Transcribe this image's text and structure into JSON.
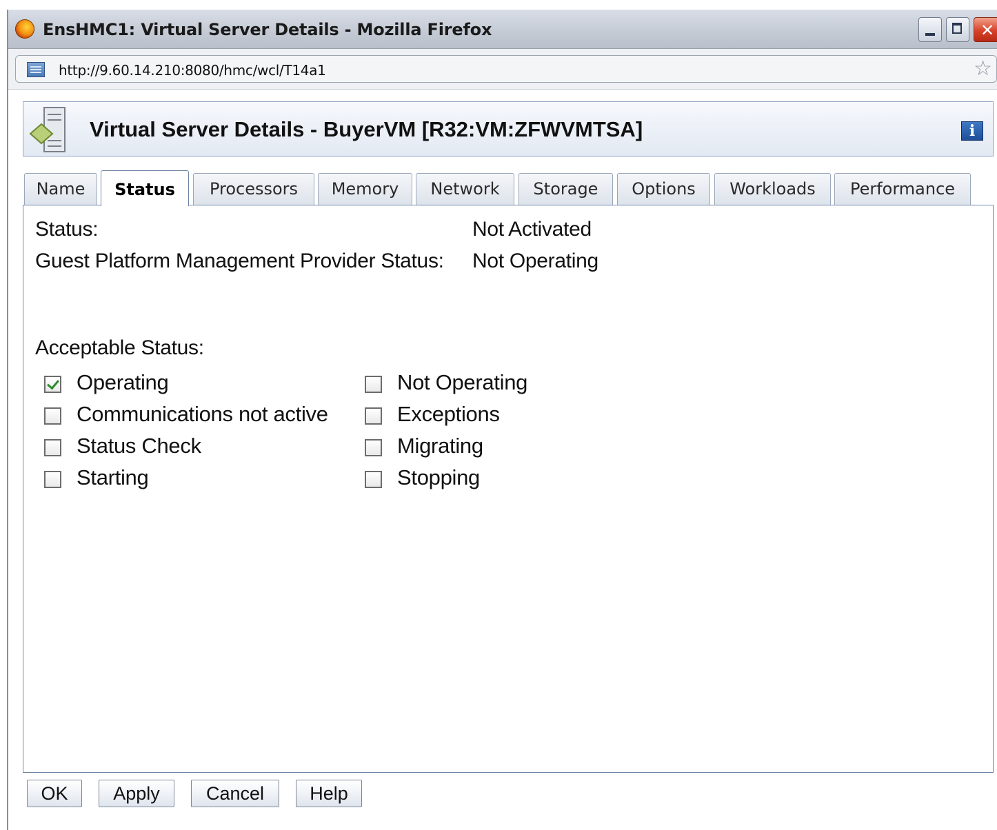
{
  "window": {
    "title": "EnsHMC1: Virtual Server Details - Mozilla Firefox",
    "url": "http://9.60.14.210:8080/hmc/wcl/T14a1",
    "close_glyph": "✕"
  },
  "header": {
    "title": "Virtual Server Details - BuyerVM [R32:VM:ZFWVMTSA]",
    "info_glyph": "i"
  },
  "tabs": [
    {
      "label": "Name",
      "active": false
    },
    {
      "label": "Status",
      "active": true
    },
    {
      "label": "Processors",
      "active": false
    },
    {
      "label": "Memory",
      "active": false
    },
    {
      "label": "Network",
      "active": false
    },
    {
      "label": "Storage",
      "active": false
    },
    {
      "label": "Options",
      "active": false
    },
    {
      "label": "Workloads",
      "active": false
    },
    {
      "label": "Performance",
      "active": false
    }
  ],
  "status": {
    "status_label": "Status:",
    "status_value": "Not Activated",
    "gpmp_label": "Guest Platform Management Provider Status:",
    "gpmp_value": "Not Operating"
  },
  "acceptable": {
    "heading": "Acceptable Status:",
    "options": [
      {
        "label": "Operating",
        "checked": true
      },
      {
        "label": "Communications not active",
        "checked": false
      },
      {
        "label": "Status Check",
        "checked": false
      },
      {
        "label": "Starting",
        "checked": false
      },
      {
        "label": "Not Operating",
        "checked": false
      },
      {
        "label": "Exceptions",
        "checked": false
      },
      {
        "label": "Migrating",
        "checked": false
      },
      {
        "label": "Stopping",
        "checked": false
      }
    ]
  },
  "buttons": {
    "ok": "OK",
    "apply": "Apply",
    "cancel": "Cancel",
    "help": "Help"
  }
}
